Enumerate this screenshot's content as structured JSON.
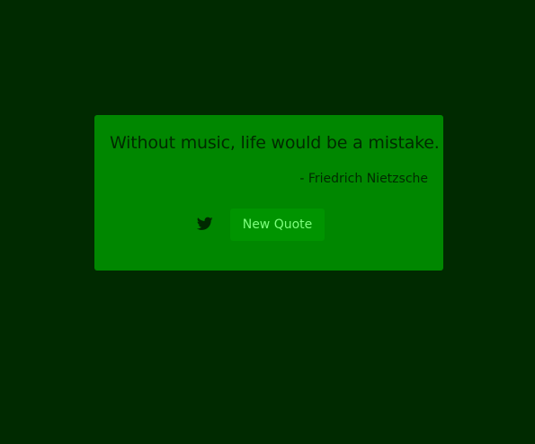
{
  "quote": {
    "text": "Without music, life would be a mistake.",
    "author": "- Friedrich Nietzsche"
  },
  "actions": {
    "tweet_icon": "twitter-icon",
    "new_quote_label": "New Quote"
  },
  "colors": {
    "background": "#002a00",
    "card": "#008700",
    "button": "#009400",
    "button_text": "#7dff7d",
    "text": "#002a00"
  }
}
